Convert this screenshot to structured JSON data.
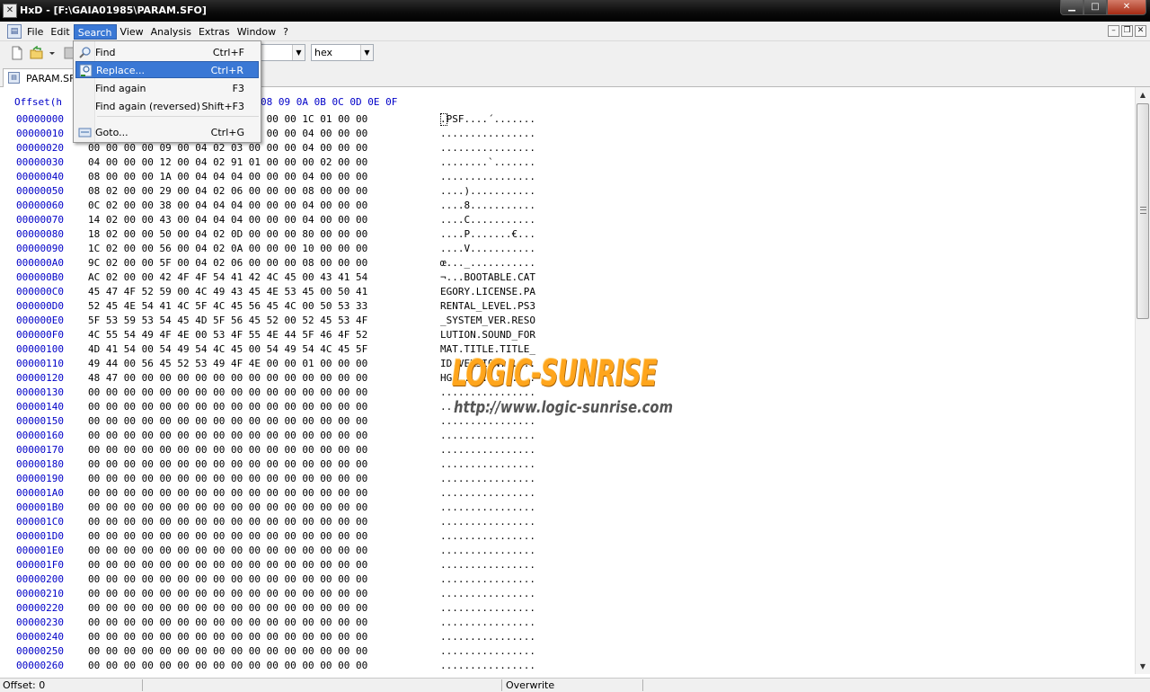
{
  "window": {
    "title": "HxD - [F:\\GAIA01985\\PARAM.SFO]",
    "app_icon_glyph": "HxD",
    "controls": [
      "minimize",
      "maximize",
      "close"
    ]
  },
  "menubar": {
    "items": [
      "File",
      "Edit",
      "Search",
      "View",
      "Analysis",
      "Extras",
      "Window",
      "?"
    ],
    "active": "Search"
  },
  "toolbar": {
    "display_mode": "hex"
  },
  "tab": {
    "label": "PARAM.SFO"
  },
  "search_menu": {
    "items": [
      {
        "label": "Find",
        "shortcut": "Ctrl+F",
        "icon": "find-icon",
        "highlighted": false
      },
      {
        "label": "Replace...",
        "shortcut": "Ctrl+R",
        "icon": "replace-icon",
        "highlighted": true
      },
      {
        "label": "Find again",
        "shortcut": "F3",
        "icon": "",
        "highlighted": false
      },
      {
        "label": "Find again (reversed)",
        "shortcut": "Shift+F3",
        "icon": "",
        "highlighted": false
      },
      {
        "label": "Goto...",
        "shortcut": "Ctrl+G",
        "icon": "goto-icon",
        "highlighted": false
      }
    ]
  },
  "hex_header": {
    "offset_label": "Offset(h",
    "columns_visible": "08 09 0A 0B 0C 0D 0E 0F"
  },
  "rows": [
    {
      "off": "00000000",
      "hex": "00 50 53 46 01 01 00 00 B4 00 00 00 1C 01 00 00",
      "txt": ".PSF....´......."
    },
    {
      "off": "00000010",
      "hex": "0C 00 00 00 04 02 00 00 04 00 00 00 04 00 00 00",
      "txt": "................"
    },
    {
      "off": "00000020",
      "hex": "00 00 00 00 09 00 04 02 03 00 00 00 04 00 00 00",
      "txt": "................"
    },
    {
      "off": "00000030",
      "hex": "04 00 00 00 12 00 04 02 91 01 00 00 00 02 00 00",
      "txt": "........`......."
    },
    {
      "off": "00000040",
      "hex": "08 00 00 00 1A 00 04 04 04 00 00 00 04 00 00 00",
      "txt": "................"
    },
    {
      "off": "00000050",
      "hex": "08 02 00 00 29 00 04 02 06 00 00 00 08 00 00 00",
      "txt": "....)..........."
    },
    {
      "off": "00000060",
      "hex": "0C 02 00 00 38 00 04 04 04 00 00 00 04 00 00 00",
      "txt": "....8..........."
    },
    {
      "off": "00000070",
      "hex": "14 02 00 00 43 00 04 04 04 00 00 00 04 00 00 00",
      "txt": "....C..........."
    },
    {
      "off": "00000080",
      "hex": "18 02 00 00 50 00 04 02 0D 00 00 00 80 00 00 00",
      "txt": "....P.......€..."
    },
    {
      "off": "00000090",
      "hex": "1C 02 00 00 56 00 04 02 0A 00 00 00 10 00 00 00",
      "txt": "....V..........."
    },
    {
      "off": "000000A0",
      "hex": "9C 02 00 00 5F 00 04 02 06 00 00 00 08 00 00 00",
      "txt": "œ..._..........."
    },
    {
      "off": "000000B0",
      "hex": "AC 02 00 00 42 4F 4F 54 41 42 4C 45 00 43 41 54",
      "txt": "¬...BOOTABLE.CAT"
    },
    {
      "off": "000000C0",
      "hex": "45 47 4F 52 59 00 4C 49 43 45 4E 53 45 00 50 41",
      "txt": "EGORY.LICENSE.PA"
    },
    {
      "off": "000000D0",
      "hex": "52 45 4E 54 41 4C 5F 4C 45 56 45 4C 00 50 53 33",
      "txt": "RENTAL_LEVEL.PS3"
    },
    {
      "off": "000000E0",
      "hex": "5F 53 59 53 54 45 4D 5F 56 45 52 00 52 45 53 4F",
      "txt": "_SYSTEM_VER.RESO"
    },
    {
      "off": "000000F0",
      "hex": "4C 55 54 49 4F 4E 00 53 4F 55 4E 44 5F 46 4F 52",
      "txt": "LUTION.SOUND_FOR"
    },
    {
      "off": "00000100",
      "hex": "4D 41 54 00 54 49 54 4C 45 00 54 49 54 4C 45 5F",
      "txt": "MAT.TITLE.TITLE_"
    },
    {
      "off": "00000110",
      "hex": "49 44 00 56 45 52 53 49 4F 4E 00 00 01 00 00 00",
      "txt": "ID.VERSION......"
    },
    {
      "off": "00000120",
      "hex": "48 47 00 00 00 00 00 00 00 00 00 00 00 00 00 00",
      "txt": "HG.............."
    },
    {
      "off": "00000130",
      "hex": "00 00 00 00 00 00 00 00 00 00 00 00 00 00 00 00",
      "txt": "................"
    },
    {
      "off": "00000140",
      "hex": "00 00 00 00 00 00 00 00 00 00 00 00 00 00 00 00",
      "txt": "................"
    },
    {
      "off": "00000150",
      "hex": "00 00 00 00 00 00 00 00 00 00 00 00 00 00 00 00",
      "txt": "................"
    },
    {
      "off": "00000160",
      "hex": "00 00 00 00 00 00 00 00 00 00 00 00 00 00 00 00",
      "txt": "................"
    },
    {
      "off": "00000170",
      "hex": "00 00 00 00 00 00 00 00 00 00 00 00 00 00 00 00",
      "txt": "................"
    },
    {
      "off": "00000180",
      "hex": "00 00 00 00 00 00 00 00 00 00 00 00 00 00 00 00",
      "txt": "................"
    },
    {
      "off": "00000190",
      "hex": "00 00 00 00 00 00 00 00 00 00 00 00 00 00 00 00",
      "txt": "................"
    },
    {
      "off": "000001A0",
      "hex": "00 00 00 00 00 00 00 00 00 00 00 00 00 00 00 00",
      "txt": "................"
    },
    {
      "off": "000001B0",
      "hex": "00 00 00 00 00 00 00 00 00 00 00 00 00 00 00 00",
      "txt": "................"
    },
    {
      "off": "000001C0",
      "hex": "00 00 00 00 00 00 00 00 00 00 00 00 00 00 00 00",
      "txt": "................"
    },
    {
      "off": "000001D0",
      "hex": "00 00 00 00 00 00 00 00 00 00 00 00 00 00 00 00",
      "txt": "................"
    },
    {
      "off": "000001E0",
      "hex": "00 00 00 00 00 00 00 00 00 00 00 00 00 00 00 00",
      "txt": "................"
    },
    {
      "off": "000001F0",
      "hex": "00 00 00 00 00 00 00 00 00 00 00 00 00 00 00 00",
      "txt": "................"
    },
    {
      "off": "00000200",
      "hex": "00 00 00 00 00 00 00 00 00 00 00 00 00 00 00 00",
      "txt": "................"
    },
    {
      "off": "00000210",
      "hex": "00 00 00 00 00 00 00 00 00 00 00 00 00 00 00 00",
      "txt": "................"
    },
    {
      "off": "00000220",
      "hex": "00 00 00 00 00 00 00 00 00 00 00 00 00 00 00 00",
      "txt": "................"
    },
    {
      "off": "00000230",
      "hex": "00 00 00 00 00 00 00 00 00 00 00 00 00 00 00 00",
      "txt": "................"
    },
    {
      "off": "00000240",
      "hex": "00 00 00 00 00 00 00 00 00 00 00 00 00 00 00 00",
      "txt": "................"
    },
    {
      "off": "00000250",
      "hex": "00 00 00 00 00 00 00 00 00 00 00 00 00 00 00 00",
      "txt": "................"
    },
    {
      "off": "00000260",
      "hex": "00 00 00 00 00 00 00 00 00 00 00 00 00 00 00 00",
      "txt": "................"
    }
  ],
  "status": {
    "offset": "Offset: 0",
    "mode": "Overwrite"
  },
  "watermark": {
    "brand": "LOGIC-SUNRISE",
    "url": "http://www.logic-sunrise.com"
  },
  "colors": {
    "offset_blue": "#0000c8",
    "menu_highlight": "#3a78d5",
    "watermark_orange": "#ffa51c"
  }
}
